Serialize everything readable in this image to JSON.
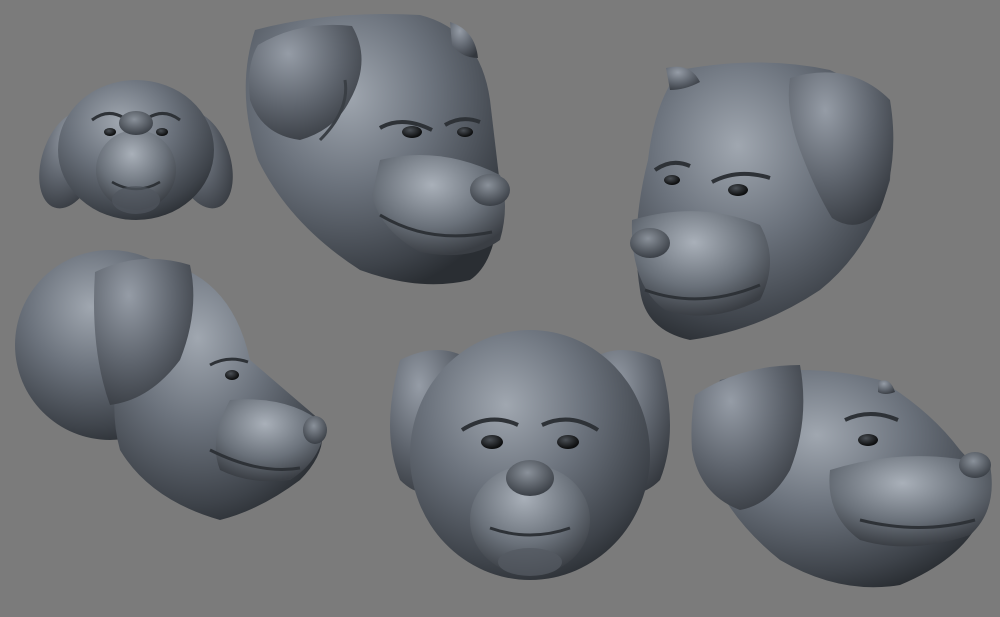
{
  "viewport": {
    "background": "#7b7b7b",
    "matcap_base": "#5a6068",
    "matcap_light": "#8f96a0",
    "matcap_shadow": "#2c3036",
    "eye_color": "#1a1a1a"
  },
  "sculpt_views": [
    "dog-head-front-small",
    "dog-head-three-quarter-right",
    "dog-head-three-quarter-left",
    "dog-head-profile-right",
    "dog-head-front-large",
    "dog-head-low-angle-right"
  ]
}
